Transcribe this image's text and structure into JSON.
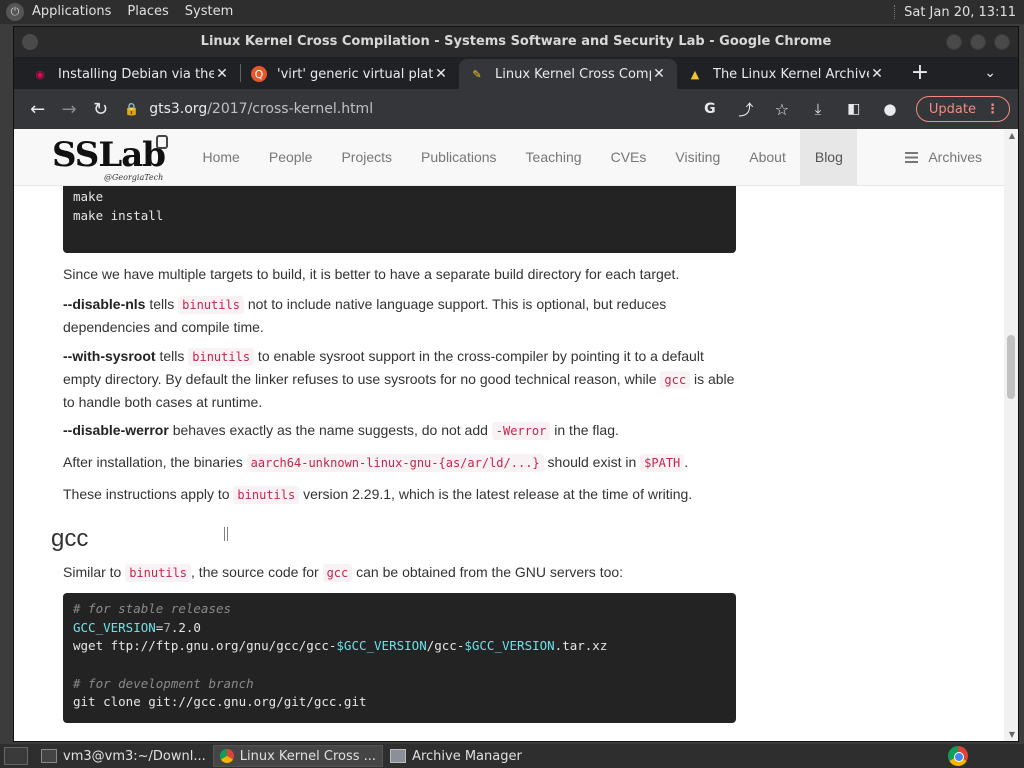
{
  "top_panel": {
    "menus": [
      "Applications",
      "Places",
      "System"
    ],
    "clock": "Sat Jan 20, 13:11"
  },
  "window": {
    "title": "Linux Kernel Cross Compilation - Systems Software and Security Lab - Google Chrome"
  },
  "tabs": [
    {
      "title": "Installing Debian via the In",
      "icon": "debian-icon",
      "active": false
    },
    {
      "title": "'virt' generic virtual platfo",
      "icon": "qemu-icon",
      "active": false
    },
    {
      "title": "Linux Kernel Cross Compi",
      "icon": "sslab-favicon",
      "active": true
    },
    {
      "title": "The Linux Kernel Archives",
      "icon": "tux-icon",
      "active": false
    }
  ],
  "toolbar": {
    "url_host": "gts3.org",
    "url_path": "/2017/cross-kernel.html",
    "update_label": "Update"
  },
  "site": {
    "brand_big": "SSLab",
    "brand_small": "@GeorgiaTech",
    "nav": [
      "Home",
      "People",
      "Projects",
      "Publications",
      "Teaching",
      "CVEs",
      "Visiting",
      "About",
      "Blog"
    ],
    "active_nav": "Blog",
    "archives": "Archives"
  },
  "article": {
    "code1": [
      "make",
      "make install"
    ],
    "p1": "Since we have multiple targets to build, it is better to have a separate build directory for each target.",
    "p2": {
      "flag": "--disable-nls",
      "a": " tells ",
      "code": "binutils",
      "b": " not to include native language support. This is optional, but reduces dependencies and compile time."
    },
    "p3": {
      "flag": "--with-sysroot",
      "a": " tells ",
      "code": "binutils",
      "b": " to enable sysroot support in the cross-compiler by pointing it to a default empty directory. By default the linker refuses to use sysroots for no good technical reason, while ",
      "code2": "gcc",
      "c": " is able to handle both cases at runtime."
    },
    "p4": {
      "flag": "--disable-werror",
      "a": " behaves exactly as the name suggests, do not add ",
      "code": "-Werror",
      "b": " in the flag."
    },
    "p5": {
      "a": "After installation, the binaries ",
      "code": "aarch64-unknown-linux-gnu-{as/ar/ld/...}",
      "b": " should exist in ",
      "code2": "$PATH",
      "c": "."
    },
    "p6": {
      "a": "These instructions apply to ",
      "code": "binutils",
      "b": " version 2.29.1, which is the latest release at the time of writing."
    },
    "h_gcc": "gcc",
    "p7": {
      "a": "Similar to ",
      "code": "binutils",
      "b": ", the source code for ",
      "code2": "gcc",
      "c": " can be obtained from the GNU servers too:"
    },
    "code2": {
      "c1": "# for stable releases",
      "var1": "GCC_VERSION",
      "eq": "=",
      "v7": "7",
      "rest": ".2.0",
      "wget_a": "wget ftp://ftp.gnu.org/gnu/gcc/gcc-",
      "wget_v1": "$GCC_VERSION",
      "wget_b": "/gcc-",
      "wget_v2": "$GCC_VERSION",
      "wget_c": ".tar.xz",
      "c2": "# for development branch",
      "clone": "git clone git://gcc.gnu.org/git/gcc.git"
    }
  },
  "taskbar": {
    "items": [
      {
        "label": "vm3@vm3:~/Downl...",
        "icon": "terminal-icon",
        "active": false
      },
      {
        "label": "Linux Kernel Cross ...",
        "icon": "chrome-icon",
        "active": true
      },
      {
        "label": "Archive Manager",
        "icon": "archive-manager-icon",
        "active": false
      }
    ]
  },
  "colors": {
    "code_bg": "#232323",
    "inline_code": "#c7254e",
    "update_accent": "#f28b82"
  }
}
